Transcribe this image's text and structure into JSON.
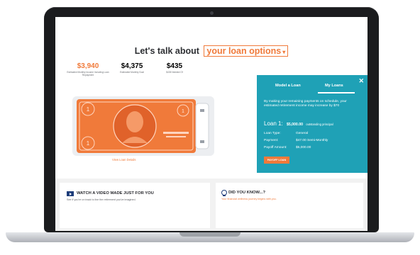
{
  "header": {
    "title_prefix": "Let's talk about",
    "title_accent": "your loan options"
  },
  "stats": [
    {
      "value": "$3,940",
      "label": "Estimated Monthly Income Including Loan Repayment",
      "color": "#f07a3a"
    },
    {
      "value": "$4,375",
      "label": "Estimated Monthly Goal",
      "color": "#2d2f33"
    },
    {
      "value": "$435",
      "label": "$435 Needed Of",
      "color": "#2d2f33"
    }
  ],
  "bill": {
    "link_label": "View Loan Details",
    "icon_color": "#f07a3a"
  },
  "panel": {
    "tabs": [
      "Model a Loan",
      "My Loans"
    ],
    "active_tab": "My Loans",
    "close_icon": "close-icon",
    "message": "By making your remaining payments on schedule, your estimated retirement income may increase by $70",
    "loan": {
      "title": "Loan 1:",
      "amount": "$5,000.00",
      "amount_note": "outstanding principal",
      "rows": [
        {
          "key": "Loan Type:",
          "value": "General"
        },
        {
          "key": "Payment:",
          "value": "$47.00 Semi-Monthly"
        },
        {
          "key": "Payoff Amount:",
          "value": "$5,000.00"
        }
      ],
      "button": "PAYOFF LOAN"
    }
  },
  "bottom": {
    "video_title": "WATCH A VIDEO MADE JUST FOR YOU",
    "video_sub": "See if you're on track to live the retirement you've imagined.",
    "did_title": "DID YOU KNOW...?",
    "did_sub": "Your financial wellness journey begins with you."
  },
  "colors": {
    "accent": "#f07a3a",
    "teal": "#1fa1b6",
    "navy": "#1e3d7a"
  }
}
